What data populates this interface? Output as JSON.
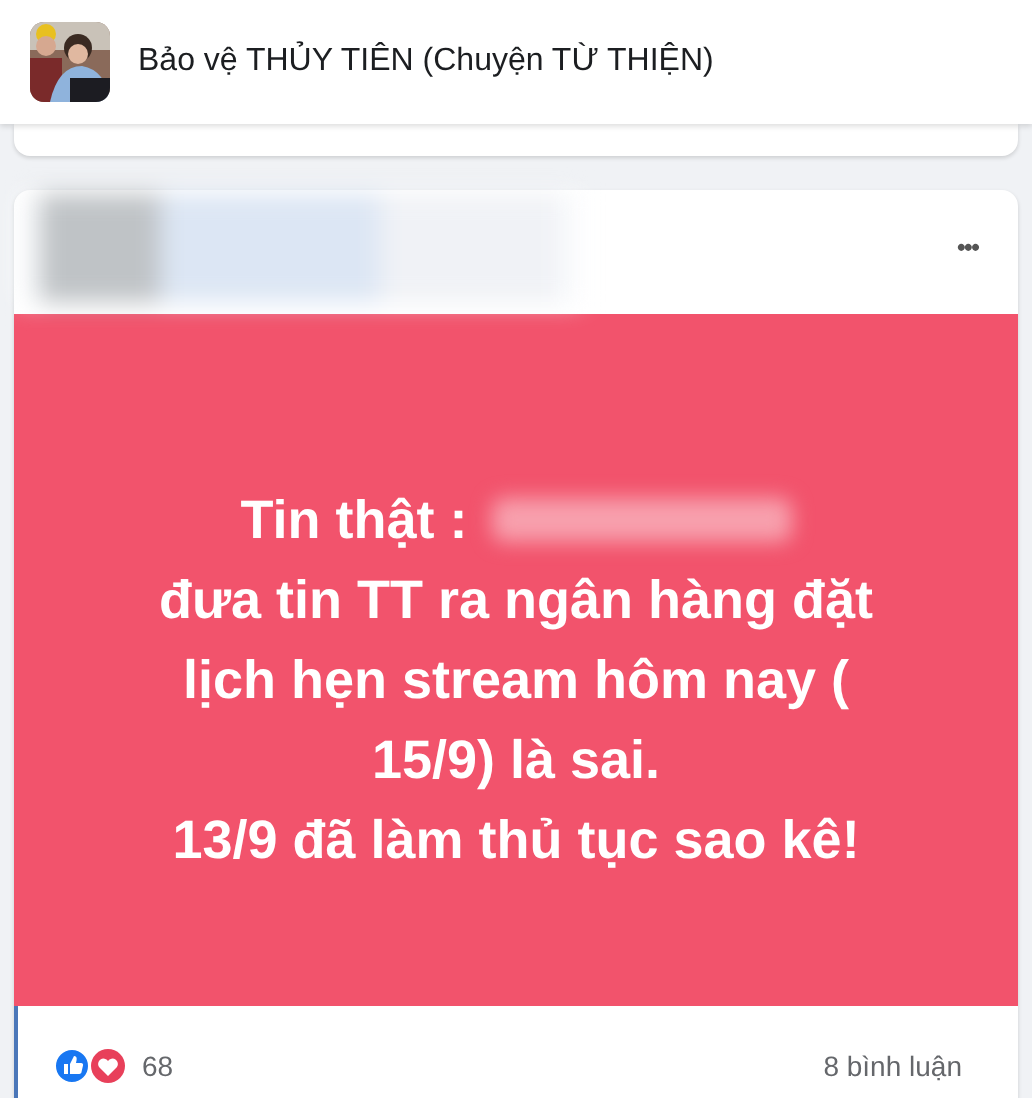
{
  "group": {
    "name": "Bảo vệ THỦY TIÊN (Chuyện TỪ THIỆN)"
  },
  "post": {
    "more": "•••",
    "lines": [
      "Tin thật :",
      "đưa tin TT ra ngân hàng đặt",
      "lịch hẹn stream hôm nay (",
      "15/9) là sai.",
      "13/9 đã làm thủ tục sao kê!"
    ],
    "reactions": "68",
    "comments": "8 bình luận"
  }
}
